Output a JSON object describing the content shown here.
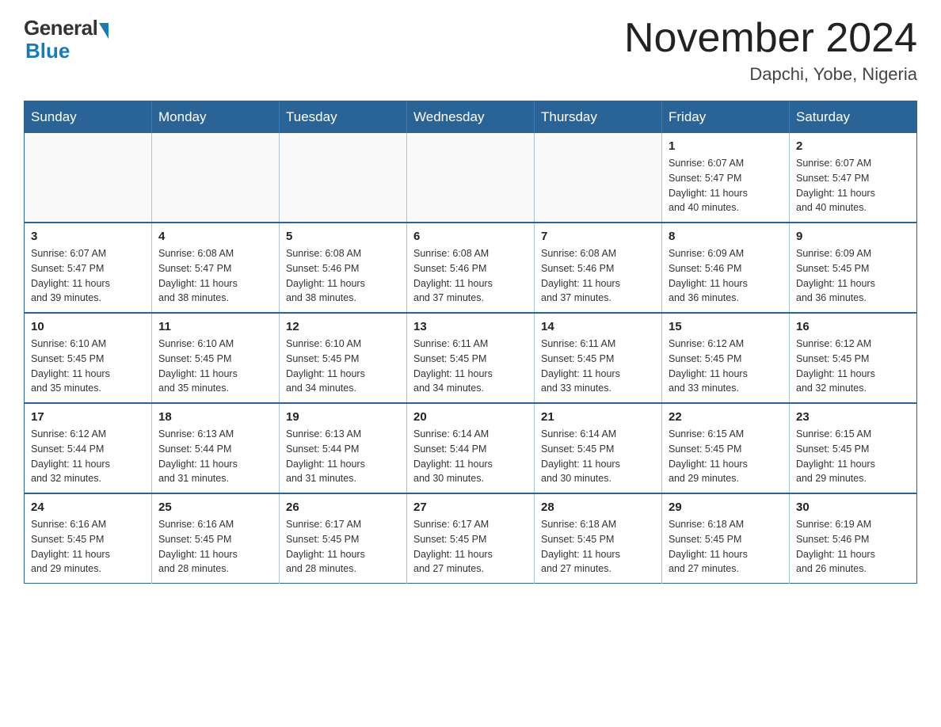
{
  "logo": {
    "general": "General",
    "blue": "Blue"
  },
  "title": "November 2024",
  "subtitle": "Dapchi, Yobe, Nigeria",
  "days_of_week": [
    "Sunday",
    "Monday",
    "Tuesday",
    "Wednesday",
    "Thursday",
    "Friday",
    "Saturday"
  ],
  "weeks": [
    [
      {
        "day": "",
        "info": ""
      },
      {
        "day": "",
        "info": ""
      },
      {
        "day": "",
        "info": ""
      },
      {
        "day": "",
        "info": ""
      },
      {
        "day": "",
        "info": ""
      },
      {
        "day": "1",
        "info": "Sunrise: 6:07 AM\nSunset: 5:47 PM\nDaylight: 11 hours\nand 40 minutes."
      },
      {
        "day": "2",
        "info": "Sunrise: 6:07 AM\nSunset: 5:47 PM\nDaylight: 11 hours\nand 40 minutes."
      }
    ],
    [
      {
        "day": "3",
        "info": "Sunrise: 6:07 AM\nSunset: 5:47 PM\nDaylight: 11 hours\nand 39 minutes."
      },
      {
        "day": "4",
        "info": "Sunrise: 6:08 AM\nSunset: 5:47 PM\nDaylight: 11 hours\nand 38 minutes."
      },
      {
        "day": "5",
        "info": "Sunrise: 6:08 AM\nSunset: 5:46 PM\nDaylight: 11 hours\nand 38 minutes."
      },
      {
        "day": "6",
        "info": "Sunrise: 6:08 AM\nSunset: 5:46 PM\nDaylight: 11 hours\nand 37 minutes."
      },
      {
        "day": "7",
        "info": "Sunrise: 6:08 AM\nSunset: 5:46 PM\nDaylight: 11 hours\nand 37 minutes."
      },
      {
        "day": "8",
        "info": "Sunrise: 6:09 AM\nSunset: 5:46 PM\nDaylight: 11 hours\nand 36 minutes."
      },
      {
        "day": "9",
        "info": "Sunrise: 6:09 AM\nSunset: 5:45 PM\nDaylight: 11 hours\nand 36 minutes."
      }
    ],
    [
      {
        "day": "10",
        "info": "Sunrise: 6:10 AM\nSunset: 5:45 PM\nDaylight: 11 hours\nand 35 minutes."
      },
      {
        "day": "11",
        "info": "Sunrise: 6:10 AM\nSunset: 5:45 PM\nDaylight: 11 hours\nand 35 minutes."
      },
      {
        "day": "12",
        "info": "Sunrise: 6:10 AM\nSunset: 5:45 PM\nDaylight: 11 hours\nand 34 minutes."
      },
      {
        "day": "13",
        "info": "Sunrise: 6:11 AM\nSunset: 5:45 PM\nDaylight: 11 hours\nand 34 minutes."
      },
      {
        "day": "14",
        "info": "Sunrise: 6:11 AM\nSunset: 5:45 PM\nDaylight: 11 hours\nand 33 minutes."
      },
      {
        "day": "15",
        "info": "Sunrise: 6:12 AM\nSunset: 5:45 PM\nDaylight: 11 hours\nand 33 minutes."
      },
      {
        "day": "16",
        "info": "Sunrise: 6:12 AM\nSunset: 5:45 PM\nDaylight: 11 hours\nand 32 minutes."
      }
    ],
    [
      {
        "day": "17",
        "info": "Sunrise: 6:12 AM\nSunset: 5:44 PM\nDaylight: 11 hours\nand 32 minutes."
      },
      {
        "day": "18",
        "info": "Sunrise: 6:13 AM\nSunset: 5:44 PM\nDaylight: 11 hours\nand 31 minutes."
      },
      {
        "day": "19",
        "info": "Sunrise: 6:13 AM\nSunset: 5:44 PM\nDaylight: 11 hours\nand 31 minutes."
      },
      {
        "day": "20",
        "info": "Sunrise: 6:14 AM\nSunset: 5:44 PM\nDaylight: 11 hours\nand 30 minutes."
      },
      {
        "day": "21",
        "info": "Sunrise: 6:14 AM\nSunset: 5:45 PM\nDaylight: 11 hours\nand 30 minutes."
      },
      {
        "day": "22",
        "info": "Sunrise: 6:15 AM\nSunset: 5:45 PM\nDaylight: 11 hours\nand 29 minutes."
      },
      {
        "day": "23",
        "info": "Sunrise: 6:15 AM\nSunset: 5:45 PM\nDaylight: 11 hours\nand 29 minutes."
      }
    ],
    [
      {
        "day": "24",
        "info": "Sunrise: 6:16 AM\nSunset: 5:45 PM\nDaylight: 11 hours\nand 29 minutes."
      },
      {
        "day": "25",
        "info": "Sunrise: 6:16 AM\nSunset: 5:45 PM\nDaylight: 11 hours\nand 28 minutes."
      },
      {
        "day": "26",
        "info": "Sunrise: 6:17 AM\nSunset: 5:45 PM\nDaylight: 11 hours\nand 28 minutes."
      },
      {
        "day": "27",
        "info": "Sunrise: 6:17 AM\nSunset: 5:45 PM\nDaylight: 11 hours\nand 27 minutes."
      },
      {
        "day": "28",
        "info": "Sunrise: 6:18 AM\nSunset: 5:45 PM\nDaylight: 11 hours\nand 27 minutes."
      },
      {
        "day": "29",
        "info": "Sunrise: 6:18 AM\nSunset: 5:45 PM\nDaylight: 11 hours\nand 27 minutes."
      },
      {
        "day": "30",
        "info": "Sunrise: 6:19 AM\nSunset: 5:46 PM\nDaylight: 11 hours\nand 26 minutes."
      }
    ]
  ]
}
